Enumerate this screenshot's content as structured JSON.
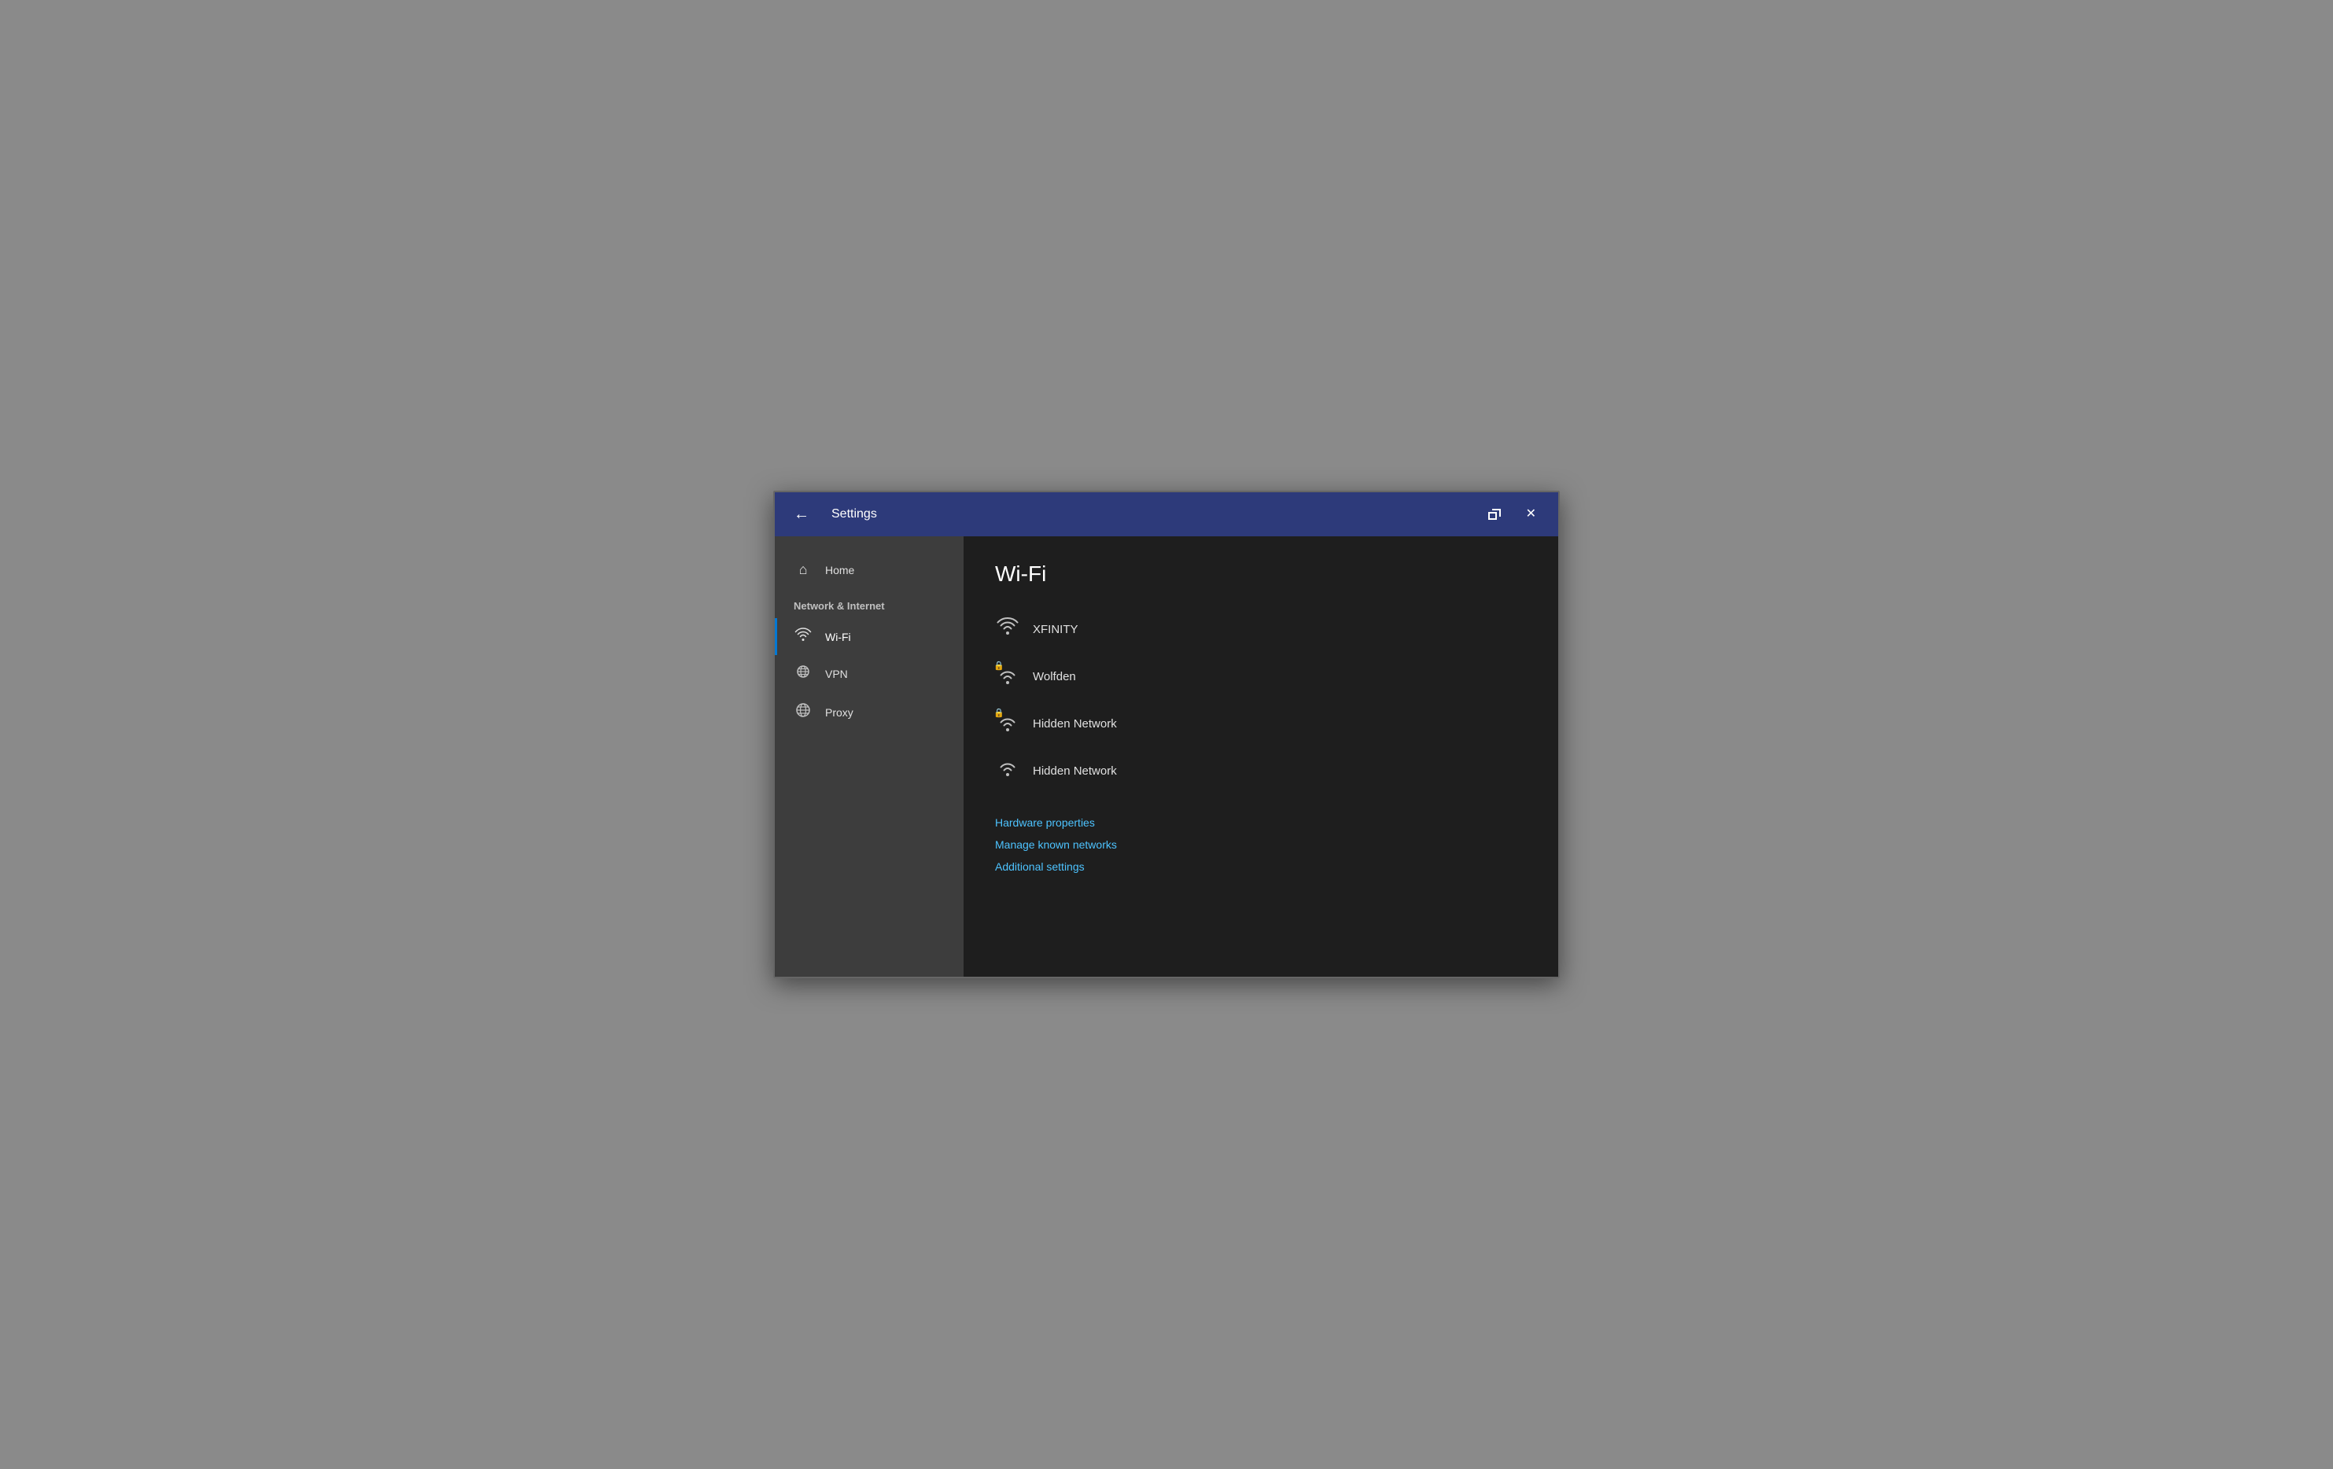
{
  "titlebar": {
    "title": "Settings",
    "back_label": "←",
    "close_label": "✕"
  },
  "sidebar": {
    "home_label": "Home",
    "section_label": "Network & Internet",
    "items": [
      {
        "id": "wifi",
        "label": "Wi-Fi",
        "icon": "wifi",
        "active": true
      },
      {
        "id": "vpn",
        "label": "VPN",
        "icon": "vpn",
        "active": false
      },
      {
        "id": "proxy",
        "label": "Proxy",
        "icon": "globe",
        "active": false
      }
    ]
  },
  "main": {
    "title": "Wi-Fi",
    "networks": [
      {
        "id": "xfinity",
        "name": "XFINITY",
        "secured": false
      },
      {
        "id": "wolfden",
        "name": "Wolfden",
        "secured": true
      },
      {
        "id": "hidden1",
        "name": "Hidden Network",
        "secured": true
      },
      {
        "id": "hidden2",
        "name": "Hidden Network",
        "secured": false
      }
    ],
    "links": [
      {
        "id": "hardware",
        "label": "Hardware properties"
      },
      {
        "id": "manage",
        "label": "Manage known networks"
      },
      {
        "id": "additional",
        "label": "Additional settings"
      }
    ]
  }
}
